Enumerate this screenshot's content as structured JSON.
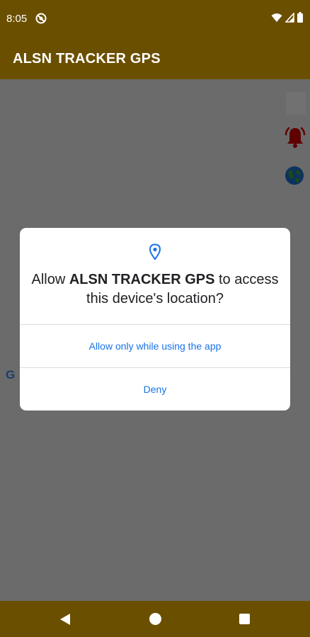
{
  "status_bar": {
    "time": "8:05"
  },
  "app_bar": {
    "title": "ALSN TRACKER GPS"
  },
  "map": {
    "google_mark": "G"
  },
  "dialog": {
    "message_prefix": "Allow ",
    "app_name": "ALSN TRACKER GPS",
    "message_suffix": " to access this device's location?",
    "allow_label": "Allow only while using the app",
    "deny_label": "Deny"
  },
  "colors": {
    "bar_background": "#6b4f00",
    "accent_blue": "#1a73e8",
    "bell_red": "#d50000"
  },
  "icons": {
    "location": "location-pin-icon",
    "bell": "alarm-bell-icon",
    "globe": "globe-icon"
  }
}
